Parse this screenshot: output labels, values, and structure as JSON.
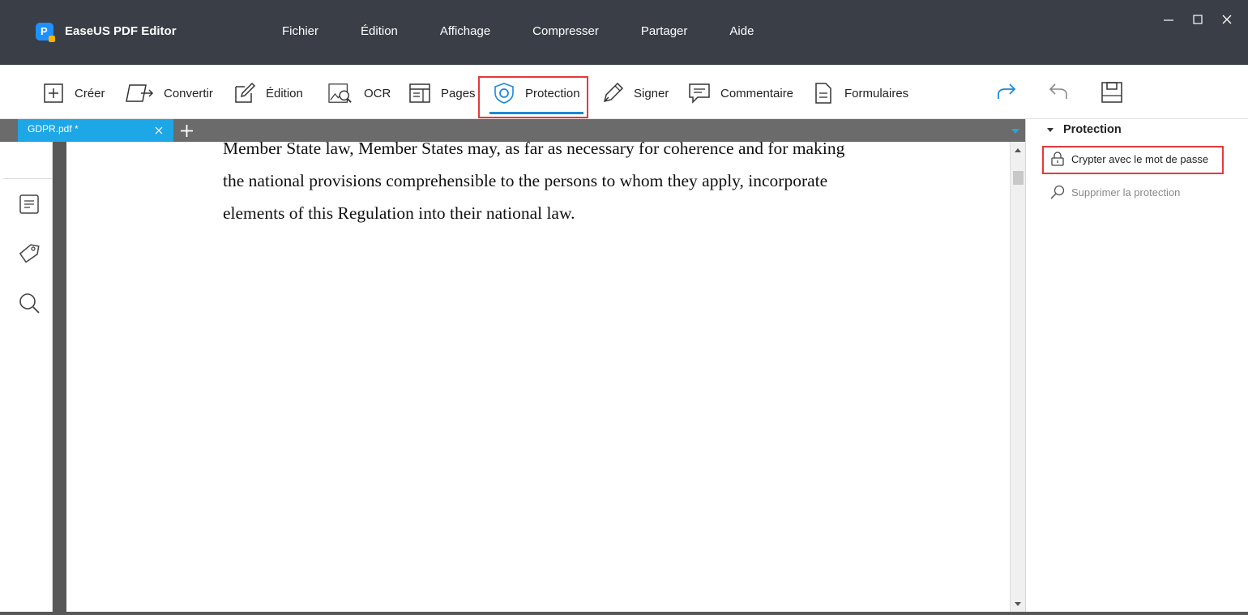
{
  "app": {
    "title": "EaseUS PDF Editor",
    "logo_letter": "P"
  },
  "menu": [
    "Fichier",
    "Édition",
    "Affichage",
    "Compresser",
    "Partager",
    "Aide"
  ],
  "toolbar": {
    "tools": [
      {
        "label": "Créer",
        "icon": "plus-box-icon"
      },
      {
        "label": "Convertir",
        "icon": "convert-icon"
      },
      {
        "label": "Édition",
        "icon": "edit-pencil-icon"
      },
      {
        "label": "OCR",
        "icon": "ocr-icon"
      },
      {
        "label": "Pages",
        "icon": "pages-icon"
      },
      {
        "label": "Protection",
        "icon": "shield-icon",
        "active": true
      },
      {
        "label": "Signer",
        "icon": "pen-icon"
      },
      {
        "label": "Commentaire",
        "icon": "comment-icon"
      },
      {
        "label": "Formulaires",
        "icon": "form-icon"
      }
    ],
    "right_icons": [
      "redo-icon",
      "undo-icon",
      "save-icon"
    ],
    "accent_color": "#1a8ad6",
    "highlight_color": "#e5383b"
  },
  "tabs": [
    {
      "label": "GDPR.pdf *",
      "color": "#1ea7e6"
    }
  ],
  "document": {
    "lines": [
      "Member State law, Member States may, as far as necessary for coherence and for making",
      "the national provisions comprehensible to the persons to whom they apply, incorporate",
      "elements of this Regulation into their national law."
    ]
  },
  "left_sidebar": {
    "icons": [
      "thumbnails-icon",
      "tag-icon",
      "search-icon"
    ]
  },
  "right_panel": {
    "header": "Protection",
    "items": [
      {
        "label": "Crypter avec le mot de passe",
        "icon": "lock-icon",
        "enabled": true
      },
      {
        "label": "Supprimer la protection",
        "icon": "search-remove-icon",
        "enabled": false
      }
    ]
  }
}
